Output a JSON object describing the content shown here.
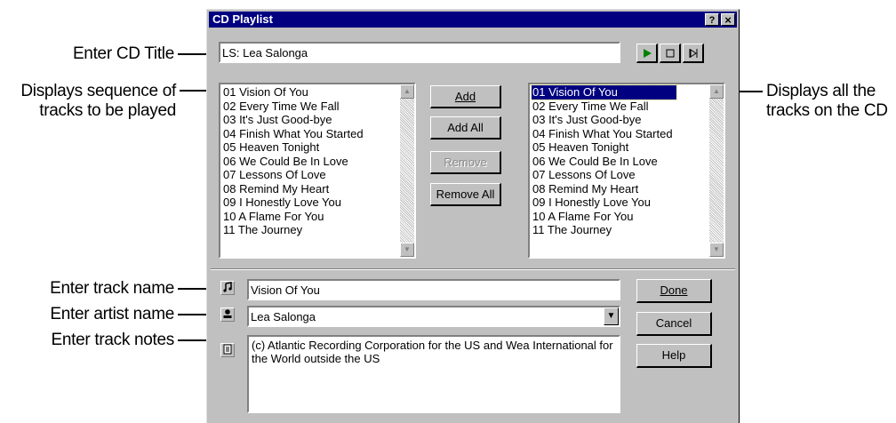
{
  "window": {
    "title": "CD Playlist",
    "help_button": "?",
    "close_button": "×"
  },
  "cd_title": {
    "value": "LS: Lea Salonga"
  },
  "play_controls": {
    "play_icon": "play-icon",
    "stop_icon": "stop-icon",
    "next_icon": "next-track-icon"
  },
  "playlist": {
    "tracks": [
      "01 Vision Of You",
      "02 Every Time We Fall",
      "03 It's Just Good-bye",
      "04 Finish What You Started",
      "05 Heaven Tonight",
      "06 We Could Be In Love",
      "07 Lessons Of Love",
      "08 Remind My Heart",
      "09 I Honestly Love You",
      "10 A Flame For You",
      "11 The Journey"
    ]
  },
  "buttons": {
    "add": "Add",
    "add_all": "Add All",
    "remove": "Remove",
    "remove_all": "Remove All",
    "done": "Done",
    "cancel": "Cancel",
    "help": "Help"
  },
  "available": {
    "tracks": [
      "01 Vision Of You",
      "02 Every Time We Fall",
      "03 It's Just Good-bye",
      "04 Finish What You Started",
      "05 Heaven Tonight",
      "06 We Could Be In Love",
      "07 Lessons Of Love",
      "08 Remind My Heart",
      "09 I Honestly Love You",
      "10 A Flame For You",
      "11 The Journey"
    ],
    "selected_index": 0
  },
  "track_name": {
    "value": "Vision Of You",
    "icon": "music-note-icon"
  },
  "artist_name": {
    "value": "Lea Salonga",
    "icon": "artist-icon"
  },
  "track_notes": {
    "value": "(c) Atlantic Recording Corporation for the US and Wea International for the World outside the US",
    "icon": "notes-icon"
  },
  "annotations": {
    "enter_cd_title": "Enter CD Title",
    "displays_sequence_line1": "Displays sequence of",
    "displays_sequence_line2": "tracks to be played",
    "displays_all_line1": "Displays all the",
    "displays_all_line2": "tracks on the CD",
    "enter_track_name": "Enter track name",
    "enter_artist_name": "Enter artist name",
    "enter_track_notes": "Enter track notes"
  }
}
